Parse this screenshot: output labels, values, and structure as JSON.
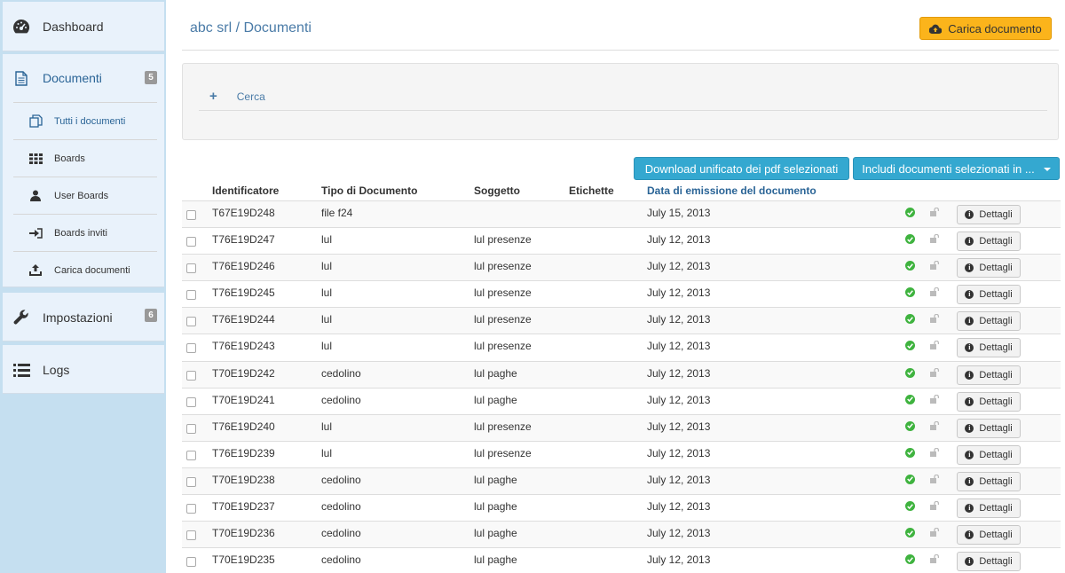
{
  "sidebar": {
    "dashboard_label": "Dashboard",
    "documenti_label": "Documenti",
    "documenti_badge": "5",
    "sub_items": [
      {
        "label": "Tutti i documenti",
        "icon": "copy-icon"
      },
      {
        "label": "Boards",
        "icon": "grid-icon"
      },
      {
        "label": "User Boards",
        "icon": "user-icon"
      },
      {
        "label": "Boards inviti",
        "icon": "sign-in-icon"
      },
      {
        "label": "Carica documenti",
        "icon": "upload-icon"
      }
    ],
    "impostazioni_label": "Impostazioni",
    "impostazioni_badge": "6",
    "logs_label": "Logs"
  },
  "header": {
    "breadcrumb": "abc srl / Documenti",
    "upload_button": "Carica documento"
  },
  "search": {
    "toggle_icon": "+",
    "label": "Cerca"
  },
  "actions": {
    "download_label": "Download unificato dei pdf selezionati",
    "include_label": "Includi documenti selezionati in ..."
  },
  "table": {
    "headers": {
      "id": "Identificatore",
      "type": "Tipo di Documento",
      "subject": "Soggetto",
      "tags": "Etichette",
      "date": "Data di emissione del documento"
    },
    "detail_label": "Dettagli",
    "detail_icon_glyph": "i",
    "rows": [
      {
        "id": "T67E19D248",
        "type": "file f24",
        "subject": "",
        "date": "July 15, 2013"
      },
      {
        "id": "T76E19D247",
        "type": "lul",
        "subject": "lul presenze",
        "date": "July 12, 2013"
      },
      {
        "id": "T76E19D246",
        "type": "lul",
        "subject": "lul presenze",
        "date": "July 12, 2013"
      },
      {
        "id": "T76E19D245",
        "type": "lul",
        "subject": "lul presenze",
        "date": "July 12, 2013"
      },
      {
        "id": "T76E19D244",
        "type": "lul",
        "subject": "lul presenze",
        "date": "July 12, 2013"
      },
      {
        "id": "T76E19D243",
        "type": "lul",
        "subject": "lul presenze",
        "date": "July 12, 2013"
      },
      {
        "id": "T70E19D242",
        "type": "cedolino",
        "subject": "lul paghe",
        "date": "July 12, 2013"
      },
      {
        "id": "T70E19D241",
        "type": "cedolino",
        "subject": "lul paghe",
        "date": "July 12, 2013"
      },
      {
        "id": "T76E19D240",
        "type": "lul",
        "subject": "lul presenze",
        "date": "July 12, 2013"
      },
      {
        "id": "T76E19D239",
        "type": "lul",
        "subject": "lul presenze",
        "date": "July 12, 2013"
      },
      {
        "id": "T70E19D238",
        "type": "cedolino",
        "subject": "lul paghe",
        "date": "July 12, 2013"
      },
      {
        "id": "T70E19D237",
        "type": "cedolino",
        "subject": "lul paghe",
        "date": "July 12, 2013"
      },
      {
        "id": "T70E19D236",
        "type": "cedolino",
        "subject": "lul paghe",
        "date": "July 12, 2013"
      },
      {
        "id": "T70E19D235",
        "type": "cedolino",
        "subject": "lul paghe",
        "date": "July 12, 2013"
      }
    ]
  },
  "colors": {
    "sidebar_bg": "#c5dff0",
    "accent_blue": "#34a8d0",
    "upload_yellow": "#fbb41b",
    "status_green": "#3fb33f"
  }
}
